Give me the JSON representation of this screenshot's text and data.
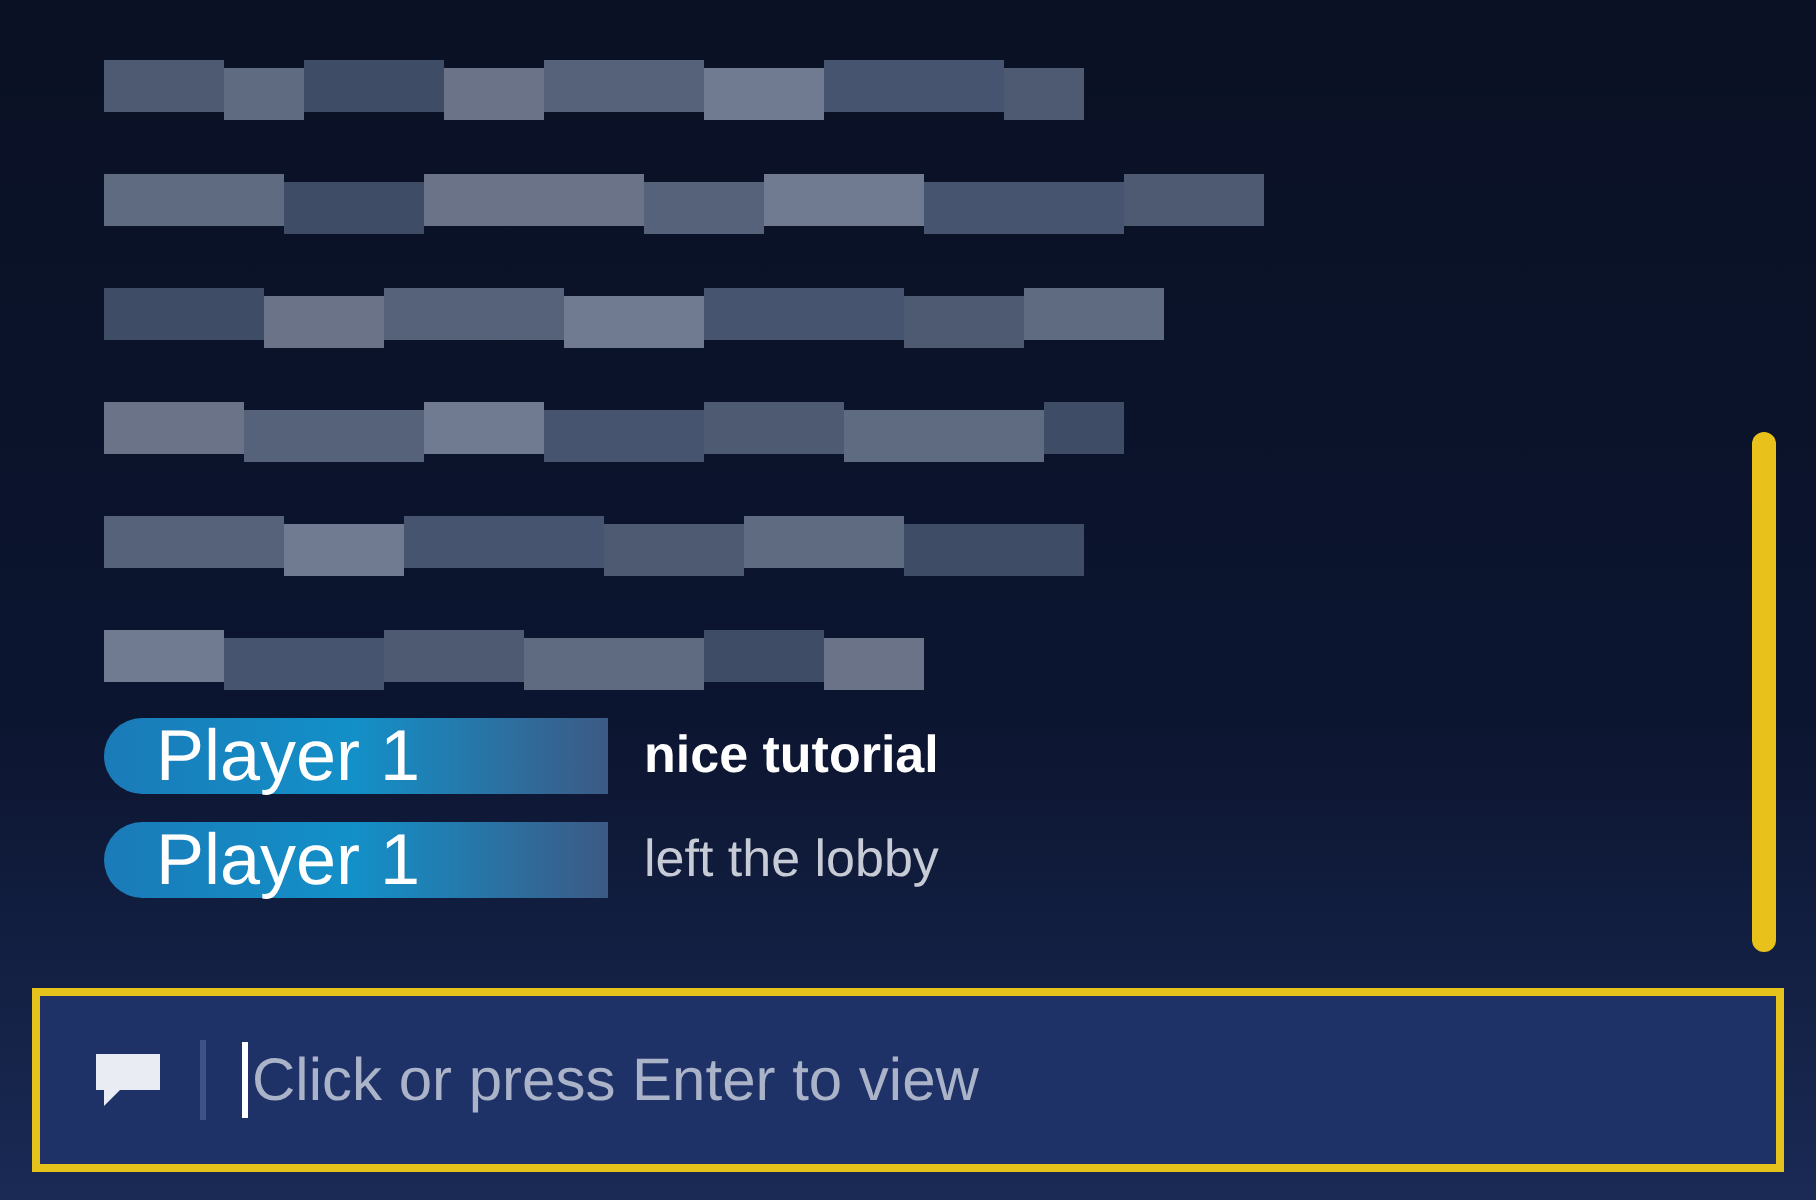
{
  "messages": [
    {
      "kind": "redacted"
    },
    {
      "kind": "redacted"
    },
    {
      "kind": "redacted"
    },
    {
      "kind": "redacted"
    },
    {
      "kind": "redacted"
    },
    {
      "kind": "redacted"
    },
    {
      "kind": "chat",
      "player": "Player 1",
      "text": "nice tutorial"
    },
    {
      "kind": "system",
      "player": "Player 1",
      "text": "left the lobby"
    }
  ],
  "chat_input": {
    "placeholder": "Click or press Enter to view"
  }
}
